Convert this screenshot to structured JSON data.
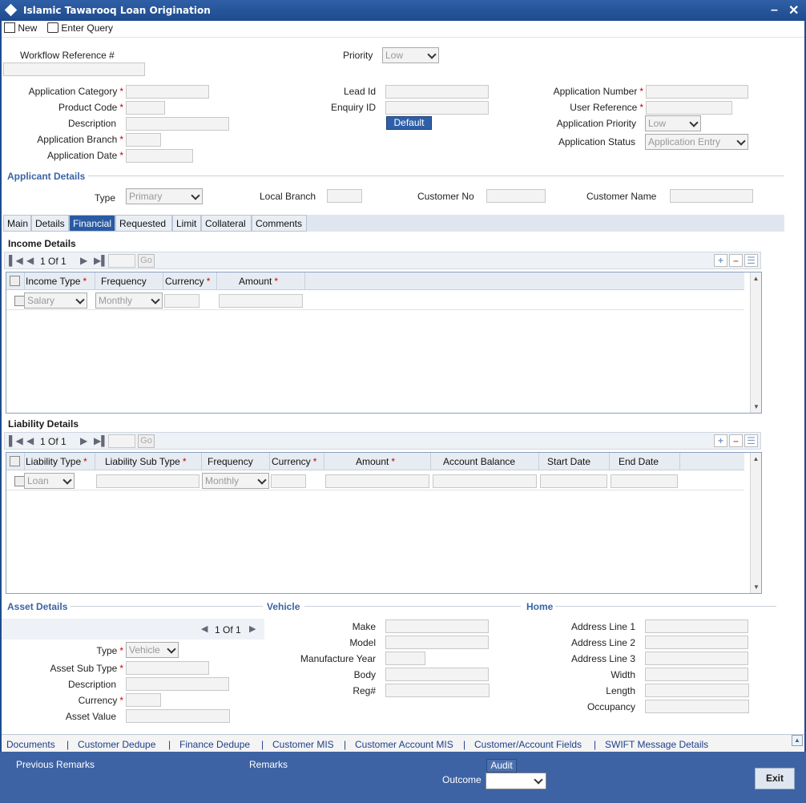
{
  "window": {
    "title": "Islamic Tawarooq Loan Origination"
  },
  "toolbar": {
    "new": "New",
    "enter_query": "Enter Query"
  },
  "header": {
    "workflow_ref_label": "Workflow Reference #",
    "priority_label": "Priority",
    "priority_value": "Low",
    "app_category_label": "Application Category",
    "product_code_label": "Product Code",
    "description_label": "Description",
    "app_branch_label": "Application Branch",
    "app_date_label": "Application Date",
    "lead_id_label": "Lead Id",
    "enquiry_id_label": "Enquiry ID",
    "default_btn": "Default",
    "app_number_label": "Application Number",
    "user_ref_label": "User Reference",
    "app_priority_label": "Application Priority",
    "app_priority_value": "Low",
    "app_status_label": "Application Status",
    "app_status_value": "Application Entry"
  },
  "applicant": {
    "title": "Applicant Details",
    "type_label": "Type",
    "type_value": "Primary",
    "local_branch_label": "Local Branch",
    "customer_no_label": "Customer No",
    "customer_name_label": "Customer Name"
  },
  "tabs": [
    "Main",
    "Details",
    "Financial",
    "Requested",
    "Limit",
    "Collateral",
    "Comments"
  ],
  "income": {
    "title": "Income Details",
    "page": "1 Of 1",
    "go": "Go",
    "cols": [
      "Income Type",
      "Frequency",
      "Currency",
      "Amount"
    ],
    "row": {
      "income_type": "Salary",
      "frequency": "Monthly"
    }
  },
  "liability": {
    "title": "Liability Details",
    "page": "1 Of 1",
    "go": "Go",
    "cols": [
      "Liability Type",
      "Liability Sub Type",
      "Frequency",
      "Currency",
      "Amount",
      "Account Balance",
      "Start Date",
      "End Date"
    ],
    "row": {
      "liability_type": "Loan",
      "frequency": "Monthly"
    }
  },
  "asset": {
    "title": "Asset Details",
    "page": "1 Of 1",
    "type_label": "Type",
    "type_value": "Vehicle",
    "sub_type_label": "Asset Sub Type",
    "description_label": "Description",
    "currency_label": "Currency",
    "value_label": "Asset Value"
  },
  "vehicle": {
    "title": "Vehicle",
    "make": "Make",
    "model": "Model",
    "year": "Manufacture Year",
    "body": "Body",
    "reg": "Reg#"
  },
  "home": {
    "title": "Home",
    "addr1": "Address Line 1",
    "addr2": "Address Line 2",
    "addr3": "Address Line 3",
    "width": "Width",
    "length": "Length",
    "occupancy": "Occupancy"
  },
  "links": [
    "Documents",
    "Customer Dedupe",
    "Finance Dedupe",
    "Customer MIS",
    "Customer Account MIS",
    "Customer/Account Fields",
    "SWIFT Message Details"
  ],
  "footer": {
    "prev_remarks": "Previous Remarks",
    "remarks": "Remarks",
    "audit": "Audit",
    "outcome": "Outcome",
    "exit": "Exit"
  }
}
